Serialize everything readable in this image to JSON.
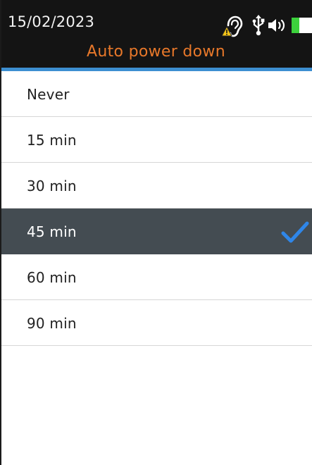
{
  "header": {
    "date": "15/02/2023",
    "title": "Auto power down",
    "icons": [
      "ear-icon",
      "usb-icon",
      "speaker-icon",
      "battery-icon"
    ]
  },
  "colors": {
    "header_bg": "#141414",
    "title": "#e8782a",
    "accent": "#3d8fd1",
    "selected_bg": "#444c52",
    "check": "#2f86e8",
    "battery": "#3cd13c",
    "warning": "#f5c518"
  },
  "options": [
    {
      "label": "Never",
      "selected": false
    },
    {
      "label": "15 min",
      "selected": false
    },
    {
      "label": "30 min",
      "selected": false
    },
    {
      "label": "45 min",
      "selected": true
    },
    {
      "label": "60 min",
      "selected": false
    },
    {
      "label": "90 min",
      "selected": false
    }
  ]
}
